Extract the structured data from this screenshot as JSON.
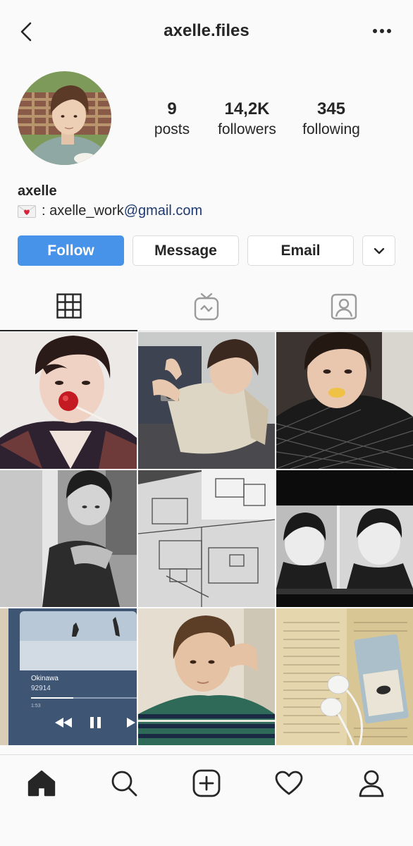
{
  "header": {
    "title": "axelle.files",
    "back_icon": "chevron-left-icon",
    "more_icon": "more-horizontal-icon"
  },
  "profile": {
    "stats": [
      {
        "value": "9",
        "label": "posts"
      },
      {
        "value": "14,2K",
        "label": "followers"
      },
      {
        "value": "345",
        "label": "following"
      }
    ],
    "name": "axelle",
    "bio_prefix": " : axelle_work",
    "bio_link": "@gmail.com",
    "bio_emoji": "love-letter-icon"
  },
  "actions": {
    "follow": "Follow",
    "message": "Message",
    "email": "Email",
    "more_icon": "chevron-down-icon"
  },
  "tabs": [
    {
      "icon": "grid-icon",
      "active": true
    },
    {
      "icon": "igtv-icon",
      "active": false
    },
    {
      "icon": "tagged-icon",
      "active": false
    }
  ],
  "posts": [
    {
      "subject": "portrait with red lollipop"
    },
    {
      "subject": "person holding camera on couch"
    },
    {
      "subject": "portrait in black mesh top"
    },
    {
      "subject": "black and white portrait"
    },
    {
      "subject": "architectural floor plans"
    },
    {
      "subject": "black and white photo on screen"
    },
    {
      "subject": "music player showing song"
    },
    {
      "subject": "portrait in striped shirt"
    },
    {
      "subject": "book with earphones and ticket"
    }
  ],
  "player": {
    "track": "Okinawa",
    "artist": "92914",
    "time": "1:53"
  },
  "bottom_nav": [
    {
      "icon": "home-icon"
    },
    {
      "icon": "search-icon"
    },
    {
      "icon": "add-post-icon"
    },
    {
      "icon": "heart-icon"
    },
    {
      "icon": "profile-icon"
    }
  ],
  "colors": {
    "accent": "#4793e9",
    "text": "#262626",
    "link": "#1e3a6f",
    "border": "#dbdbdb",
    "background": "#fafafa"
  }
}
